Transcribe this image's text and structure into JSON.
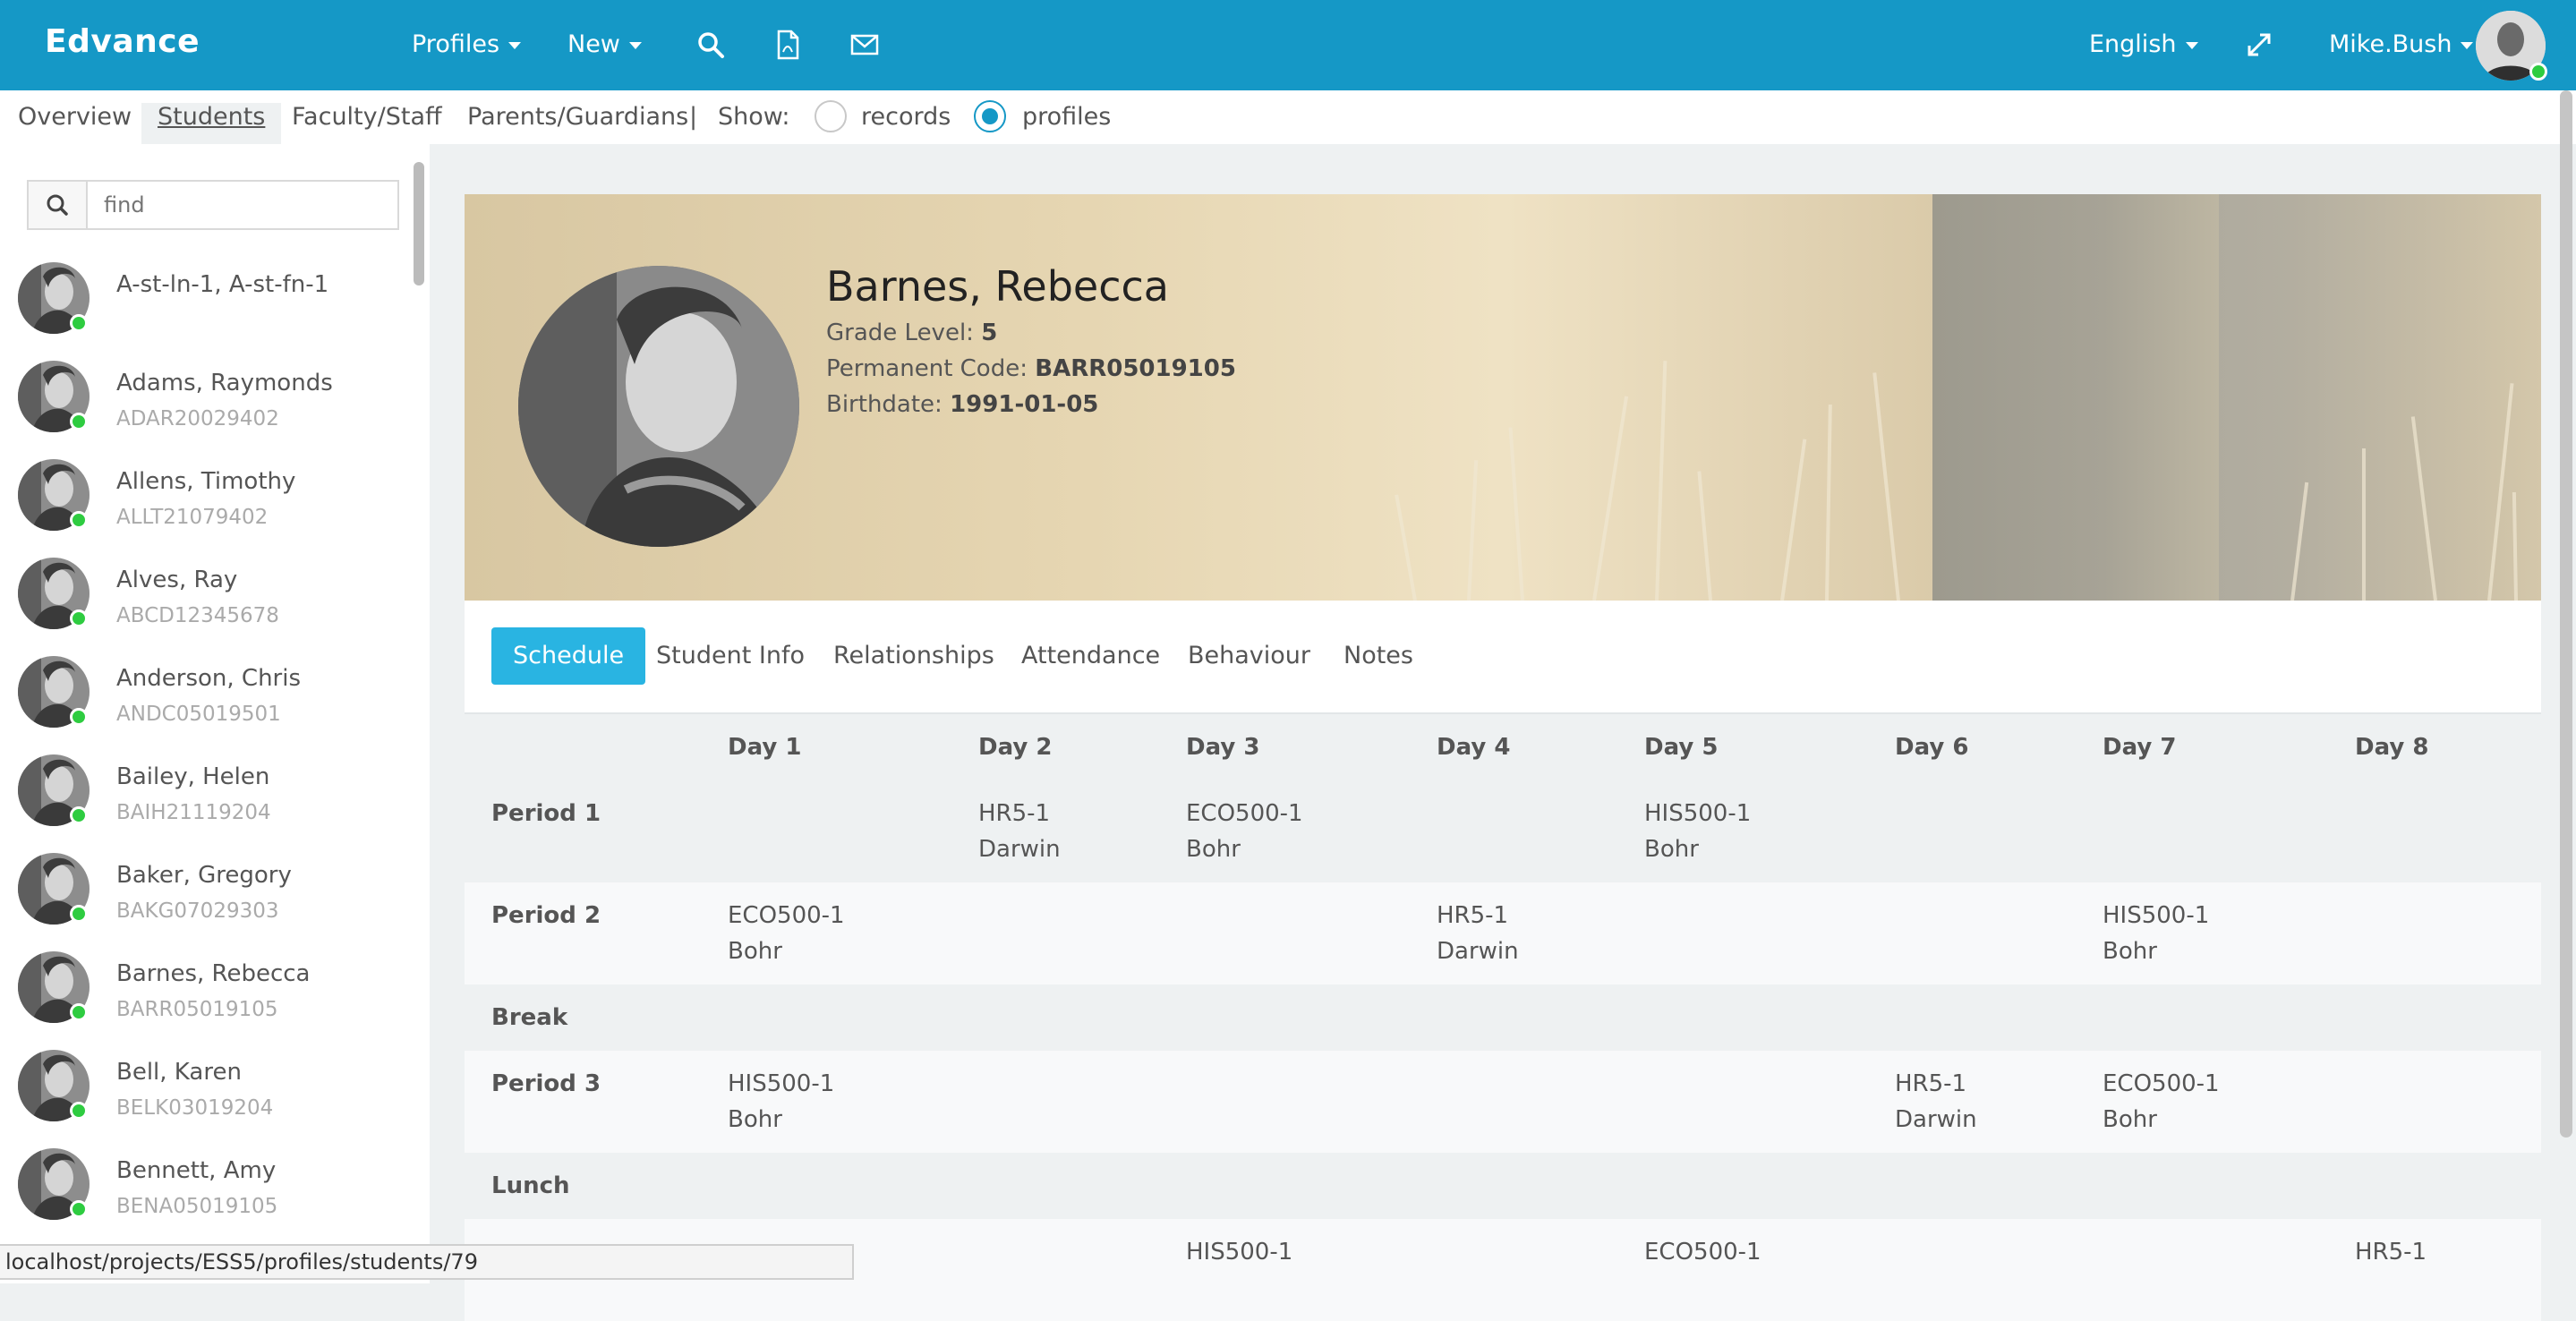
{
  "header": {
    "brand": "Edvance",
    "profiles_menu": "Profiles",
    "new_menu": "New",
    "language": "English",
    "user": "Mike.Bush"
  },
  "subnav": {
    "tabs": [
      "Overview",
      "Students",
      "Faculty/Staff",
      "Parents/Guardians"
    ],
    "separator": "|",
    "show_label": "Show:",
    "option_records": "records",
    "option_profiles": "profiles",
    "selected": "profiles"
  },
  "sidebar": {
    "search_placeholder": "find",
    "students": [
      {
        "name": "A-st-ln-1, A-st-fn-1",
        "code": ""
      },
      {
        "name": "Adams, Raymonds",
        "code": "ADAR20029402"
      },
      {
        "name": "Allens, Timothy",
        "code": "ALLT21079402"
      },
      {
        "name": "Alves, Ray",
        "code": "ABCD12345678"
      },
      {
        "name": "Anderson, Chris",
        "code": "ANDC05019501"
      },
      {
        "name": "Bailey, Helen",
        "code": "BAIH21119204"
      },
      {
        "name": "Baker, Gregory",
        "code": "BAKG07029303"
      },
      {
        "name": "Barnes, Rebecca",
        "code": "BARR05019105"
      },
      {
        "name": "Bell, Karen",
        "code": "BELK03019204"
      },
      {
        "name": "Bennett, Amy",
        "code": "BENA05019105"
      }
    ]
  },
  "profile": {
    "name": "Barnes, Rebecca",
    "grade_label": "Grade Level:",
    "grade": "5",
    "code_label": "Permanent Code:",
    "code": "BARR05019105",
    "birth_label": "Birthdate:",
    "birthdate": "1991-01-05"
  },
  "tabs": [
    "Schedule",
    "Student Info",
    "Relationships",
    "Attendance",
    "Behaviour",
    "Notes"
  ],
  "schedule": {
    "days": [
      "Day 1",
      "Day 2",
      "Day 3",
      "Day 4",
      "Day 5",
      "Day 6",
      "Day 7",
      "Day 8"
    ],
    "rows": [
      {
        "label": "Period 1",
        "cells": [
          [
            "",
            ""
          ],
          [
            "HR5-1",
            "Darwin"
          ],
          [
            "ECO500-1",
            "Bohr"
          ],
          [
            "",
            ""
          ],
          [
            "HIS500-1",
            "Bohr"
          ],
          [
            "",
            ""
          ],
          [
            "",
            ""
          ],
          [
            "",
            ""
          ]
        ]
      },
      {
        "label": "Period 2",
        "cells": [
          [
            "ECO500-1",
            "Bohr"
          ],
          [
            "",
            ""
          ],
          [
            "",
            ""
          ],
          [
            "HR5-1",
            "Darwin"
          ],
          [
            "",
            ""
          ],
          [
            "",
            ""
          ],
          [
            "HIS500-1",
            "Bohr"
          ],
          [
            "",
            ""
          ]
        ]
      },
      {
        "label": "Break",
        "cells": []
      },
      {
        "label": "Period 3",
        "cells": [
          [
            "HIS500-1",
            "Bohr"
          ],
          [
            "",
            ""
          ],
          [
            "",
            ""
          ],
          [
            "",
            ""
          ],
          [
            "",
            ""
          ],
          [
            "HR5-1",
            "Darwin"
          ],
          [
            "ECO500-1",
            "Bohr"
          ],
          [
            "",
            ""
          ]
        ]
      },
      {
        "label": "Lunch",
        "cells": []
      },
      {
        "label": "",
        "cells": [
          [
            "",
            ""
          ],
          [
            "",
            ""
          ],
          [
            "HIS500-1",
            ""
          ],
          [
            "",
            ""
          ],
          [
            "ECO500-1",
            ""
          ],
          [
            "",
            ""
          ],
          [
            "",
            ""
          ],
          [
            "HR5-1",
            ""
          ]
        ]
      }
    ]
  },
  "status_bar": {
    "url": "localhost/projects/ESS5/profiles/students/79"
  },
  "colors": {
    "brand_blue": "#1598c6",
    "active_tab": "#29b4e2",
    "online": "#2ecc40"
  }
}
